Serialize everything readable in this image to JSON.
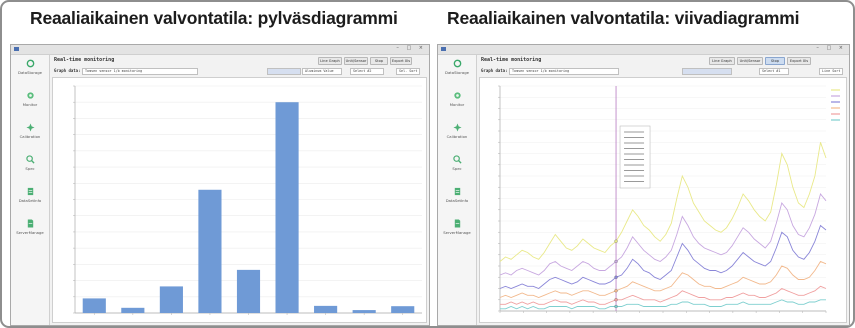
{
  "captions": {
    "left": "Reaaliaikainen valvontatila: pylväsdiagrammi",
    "right": "Reaaliaikainen valvontatila: viivadiagrammi"
  },
  "colors": {
    "bar": "#6f9ad6",
    "cursor": "#b678c0",
    "series": [
      "#e9e98a",
      "#c8a8e0",
      "#8a86d8",
      "#f2b98d",
      "#f0a0a0",
      "#7ecfcf"
    ]
  },
  "windows": [
    {
      "window_controls": "– □ ×",
      "sidebar": [
        {
          "icon": "refresh-icon",
          "label": "DataStorage"
        },
        {
          "icon": "monitor-icon",
          "label": "Monitor"
        },
        {
          "icon": "calibration-icon",
          "label": "Calibration"
        },
        {
          "icon": "spec-icon",
          "label": "Spec"
        },
        {
          "icon": "database-icon",
          "label": "DataSetInfo"
        },
        {
          "icon": "file-icon",
          "label": "ServerManage"
        }
      ],
      "pane_title": "Real-time monitoring",
      "buttons": [
        "Line Graph",
        "Unit/Sensor",
        "Stop",
        "Export Xls"
      ],
      "graph_data_label": "Graph data:",
      "inputs": [
        "Tomsen sensor 1/b monitoring",
        "",
        "Aluminum Value",
        "Select #2",
        "Sel. Sort"
      ]
    },
    {
      "window_controls": "– □ ×",
      "sidebar": [
        {
          "icon": "refresh-icon",
          "label": "DataStorage"
        },
        {
          "icon": "monitor-icon",
          "label": "Monitor"
        },
        {
          "icon": "calibration-icon",
          "label": "Calibration"
        },
        {
          "icon": "spec-icon",
          "label": "Spec"
        },
        {
          "icon": "database-icon",
          "label": "DataSetInfo"
        },
        {
          "icon": "file-icon",
          "label": "ServerManage"
        }
      ],
      "pane_title": "Real-time monitoring",
      "buttons": [
        "Line Graph",
        "Unit/Sensor",
        "Stop",
        "Export Xls"
      ],
      "graph_data_label": "Graph data:",
      "inputs": [
        "Tomsen sensor 1/b monitoring",
        "",
        "Select #1",
        "Line Sort"
      ]
    }
  ],
  "chart_data": [
    {
      "type": "bar",
      "categories": [
        "a",
        "b",
        "c",
        "d",
        "e",
        "f",
        "g",
        "h",
        "i"
      ],
      "values": [
        4.5,
        1.6,
        8.2,
        38,
        13.3,
        65,
        2.2,
        0.9,
        2.1
      ],
      "ylim": [
        0,
        70
      ],
      "grid": "horizontal"
    },
    {
      "type": "line",
      "x": [
        0,
        1,
        2,
        3,
        4,
        5,
        6,
        7,
        8,
        9,
        10,
        11,
        12,
        13,
        14,
        15,
        16,
        17,
        18,
        19,
        20,
        21,
        22,
        23,
        24,
        25,
        26,
        27,
        28,
        29,
        30,
        31,
        32,
        33,
        34,
        35,
        36,
        37,
        38,
        39,
        40,
        41,
        42,
        43,
        44,
        45,
        46,
        47,
        48,
        49,
        50,
        51,
        52,
        53,
        54,
        55,
        56,
        57,
        58,
        59
      ],
      "ylim": [
        0,
        100
      ],
      "series": [
        {
          "values": [
            22,
            24,
            23,
            25,
            27,
            26,
            24,
            23,
            26,
            30,
            34,
            31,
            28,
            27,
            29,
            32,
            30,
            28,
            27,
            26,
            29,
            31,
            35,
            40,
            45,
            42,
            38,
            36,
            33,
            31,
            34,
            39,
            50,
            60,
            55,
            48,
            44,
            40,
            38,
            36,
            35,
            37,
            41,
            46,
            52,
            49,
            45,
            42,
            40,
            44,
            56,
            70,
            65,
            55,
            48,
            46,
            52,
            60,
            75,
            68
          ]
        },
        {
          "values": [
            16,
            17,
            16,
            18,
            19,
            18,
            17,
            16,
            18,
            21,
            22,
            20,
            19,
            18,
            20,
            22,
            21,
            19,
            18,
            18,
            20,
            22,
            24,
            28,
            33,
            30,
            27,
            25,
            23,
            22,
            24,
            27,
            34,
            42,
            38,
            33,
            30,
            28,
            27,
            26,
            25,
            26,
            29,
            33,
            37,
            35,
            32,
            30,
            28,
            31,
            39,
            48,
            45,
            38,
            34,
            33,
            37,
            43,
            52,
            49
          ]
        },
        {
          "values": [
            10,
            11,
            10,
            11,
            12,
            11,
            11,
            10,
            12,
            14,
            15,
            14,
            13,
            12,
            13,
            15,
            14,
            13,
            12,
            12,
            13,
            15,
            16,
            19,
            23,
            21,
            18,
            17,
            15,
            14,
            16,
            18,
            24,
            30,
            27,
            23,
            21,
            19,
            18,
            18,
            17,
            18,
            20,
            23,
            26,
            24,
            22,
            21,
            20,
            22,
            28,
            35,
            33,
            27,
            24,
            23,
            26,
            31,
            38,
            36
          ]
        },
        {
          "values": [
            6,
            7,
            6,
            7,
            8,
            7,
            7,
            6,
            7,
            8,
            9,
            8,
            8,
            7,
            8,
            9,
            9,
            8,
            7,
            7,
            8,
            9,
            10,
            11,
            13,
            12,
            11,
            10,
            9,
            9,
            10,
            11,
            14,
            17,
            16,
            14,
            12,
            11,
            11,
            10,
            10,
            11,
            12,
            13,
            15,
            14,
            13,
            12,
            12,
            13,
            16,
            20,
            19,
            16,
            14,
            14,
            15,
            18,
            22,
            21
          ]
        },
        {
          "values": [
            3,
            3,
            4,
            3,
            4,
            3,
            4,
            3,
            3,
            4,
            5,
            4,
            4,
            3,
            4,
            5,
            4,
            4,
            3,
            3,
            4,
            5,
            5,
            6,
            7,
            6,
            5,
            5,
            5,
            4,
            5,
            6,
            7,
            9,
            8,
            7,
            6,
            6,
            5,
            5,
            5,
            6,
            6,
            7,
            8,
            7,
            7,
            6,
            6,
            7,
            8,
            10,
            9,
            8,
            7,
            7,
            8,
            9,
            11,
            10
          ]
        },
        {
          "values": [
            1,
            1,
            2,
            1,
            2,
            1,
            2,
            1,
            1,
            2,
            2,
            2,
            2,
            1,
            2,
            2,
            2,
            2,
            1,
            1,
            2,
            2,
            2,
            3,
            3,
            3,
            2,
            2,
            2,
            2,
            2,
            3,
            3,
            4,
            4,
            3,
            3,
            3,
            2,
            2,
            2,
            3,
            3,
            3,
            4,
            3,
            3,
            3,
            3,
            3,
            4,
            5,
            4,
            4,
            3,
            3,
            4,
            4,
            5,
            5
          ]
        }
      ],
      "cursor_x": 21,
      "grid": "horizontal",
      "legend": "top-right"
    }
  ]
}
